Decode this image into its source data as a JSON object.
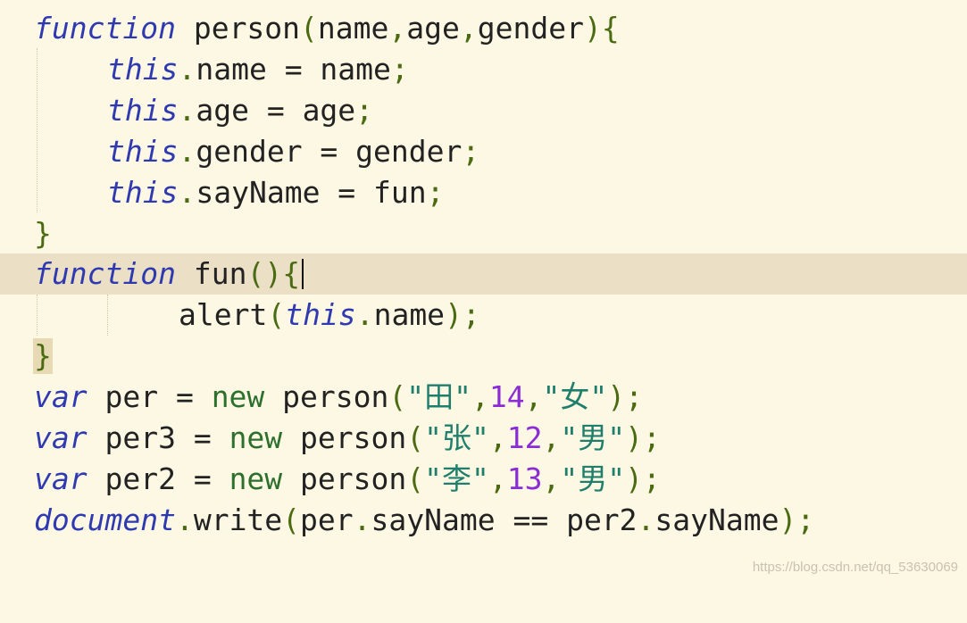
{
  "editor": {
    "lines": [
      {
        "tokens": [
          {
            "t": "function",
            "c": "kw"
          },
          {
            "t": " ",
            "c": "ident"
          },
          {
            "t": "person",
            "c": "ident"
          },
          {
            "t": "(",
            "c": "punc"
          },
          {
            "t": "name",
            "c": "ident"
          },
          {
            "t": ",",
            "c": "punc"
          },
          {
            "t": "age",
            "c": "ident"
          },
          {
            "t": ",",
            "c": "punc"
          },
          {
            "t": "gender",
            "c": "ident"
          },
          {
            "t": ")",
            "c": "punc"
          },
          {
            "t": "{",
            "c": "punc"
          }
        ]
      },
      {
        "tokens": [
          {
            "t": "this",
            "c": "kw"
          },
          {
            "t": ".",
            "c": "punc"
          },
          {
            "t": "name = name",
            "c": "ident"
          },
          {
            "t": ";",
            "c": "punc"
          }
        ]
      },
      {
        "tokens": [
          {
            "t": "this",
            "c": "kw"
          },
          {
            "t": ".",
            "c": "punc"
          },
          {
            "t": "age = age",
            "c": "ident"
          },
          {
            "t": ";",
            "c": "punc"
          }
        ]
      },
      {
        "tokens": [
          {
            "t": "this",
            "c": "kw"
          },
          {
            "t": ".",
            "c": "punc"
          },
          {
            "t": "gender = gender",
            "c": "ident"
          },
          {
            "t": ";",
            "c": "punc"
          }
        ]
      },
      {
        "tokens": [
          {
            "t": "this",
            "c": "kw"
          },
          {
            "t": ".",
            "c": "punc"
          },
          {
            "t": "sayName = fun",
            "c": "ident"
          },
          {
            "t": ";",
            "c": "punc"
          }
        ]
      },
      {
        "tokens": [
          {
            "t": "}",
            "c": "punc"
          }
        ]
      },
      {
        "tokens": [
          {
            "t": "function",
            "c": "kw"
          },
          {
            "t": " ",
            "c": "ident"
          },
          {
            "t": "fun",
            "c": "ident"
          },
          {
            "t": "()",
            "c": "punc"
          },
          {
            "t": "{",
            "c": "punc"
          }
        ]
      },
      {
        "tokens": [
          {
            "t": "alert",
            "c": "ident"
          },
          {
            "t": "(",
            "c": "punc"
          },
          {
            "t": "this",
            "c": "kw"
          },
          {
            "t": ".",
            "c": "punc"
          },
          {
            "t": "name",
            "c": "ident"
          },
          {
            "t": ");",
            "c": "punc"
          }
        ]
      },
      {
        "tokens": [
          {
            "t": "}",
            "c": "punc"
          }
        ]
      },
      {
        "tokens": [
          {
            "t": "var",
            "c": "kw"
          },
          {
            "t": " per = ",
            "c": "ident"
          },
          {
            "t": "new",
            "c": "kw-plain"
          },
          {
            "t": " person",
            "c": "ident"
          },
          {
            "t": "(",
            "c": "punc"
          },
          {
            "t": "\"田\"",
            "c": "str"
          },
          {
            "t": ",",
            "c": "punc"
          },
          {
            "t": "14",
            "c": "num"
          },
          {
            "t": ",",
            "c": "punc"
          },
          {
            "t": "\"女\"",
            "c": "str"
          },
          {
            "t": ");",
            "c": "punc"
          }
        ]
      },
      {
        "tokens": [
          {
            "t": "var",
            "c": "kw"
          },
          {
            "t": " per3 = ",
            "c": "ident"
          },
          {
            "t": "new",
            "c": "kw-plain"
          },
          {
            "t": " person",
            "c": "ident"
          },
          {
            "t": "(",
            "c": "punc"
          },
          {
            "t": "\"张\"",
            "c": "str"
          },
          {
            "t": ",",
            "c": "punc"
          },
          {
            "t": "12",
            "c": "num"
          },
          {
            "t": ",",
            "c": "punc"
          },
          {
            "t": "\"男\"",
            "c": "str"
          },
          {
            "t": ");",
            "c": "punc"
          }
        ]
      },
      {
        "tokens": [
          {
            "t": "var",
            "c": "kw"
          },
          {
            "t": " per2 = ",
            "c": "ident"
          },
          {
            "t": "new",
            "c": "kw-plain"
          },
          {
            "t": " person",
            "c": "ident"
          },
          {
            "t": "(",
            "c": "punc"
          },
          {
            "t": "\"李\"",
            "c": "str"
          },
          {
            "t": ",",
            "c": "punc"
          },
          {
            "t": "13",
            "c": "num"
          },
          {
            "t": ",",
            "c": "punc"
          },
          {
            "t": "\"男\"",
            "c": "str"
          },
          {
            "t": ");",
            "c": "punc"
          }
        ]
      },
      {
        "tokens": [
          {
            "t": "document",
            "c": "kw"
          },
          {
            "t": ".",
            "c": "punc"
          },
          {
            "t": "write",
            "c": "ident"
          },
          {
            "t": "(",
            "c": "punc"
          },
          {
            "t": "per",
            "c": "ident"
          },
          {
            "t": ".",
            "c": "punc"
          },
          {
            "t": "sayName == per2",
            "c": "ident"
          },
          {
            "t": ".",
            "c": "punc"
          },
          {
            "t": "sayName",
            "c": "ident"
          },
          {
            "t": ");",
            "c": "punc"
          }
        ]
      }
    ]
  },
  "colors": {
    "background": "#fdf8e3",
    "current_line": "#ebe0c6",
    "keyword": "#2f3ab0",
    "new_keyword": "#2d6f2d",
    "punctuation": "#4a6b12",
    "string": "#1f7f6c",
    "number": "#8b2cd4",
    "identifier": "#222222"
  },
  "watermark": "https://blog.csdn.net/qq_53630069"
}
